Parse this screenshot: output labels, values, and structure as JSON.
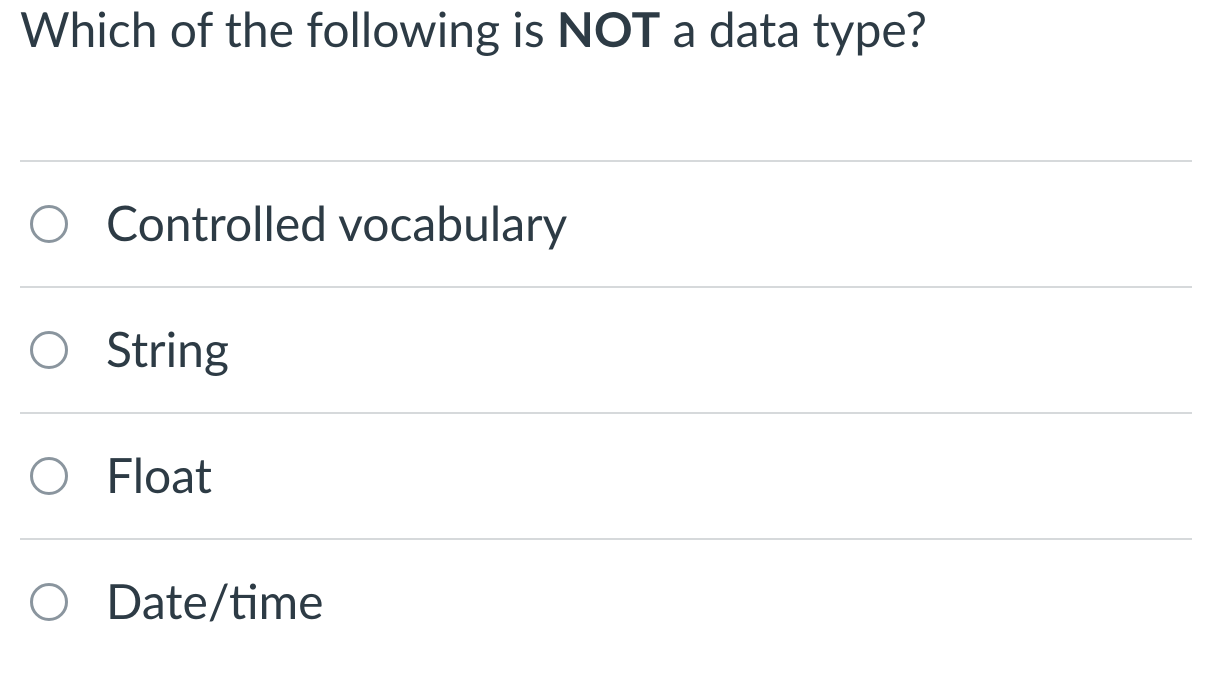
{
  "question": {
    "prefix": "Which of the following is ",
    "emphasis": "NOT",
    "suffix": " a data type?"
  },
  "options": [
    {
      "label": "Controlled vocabulary"
    },
    {
      "label": "String"
    },
    {
      "label": "Float"
    },
    {
      "label": "Date/time"
    }
  ]
}
